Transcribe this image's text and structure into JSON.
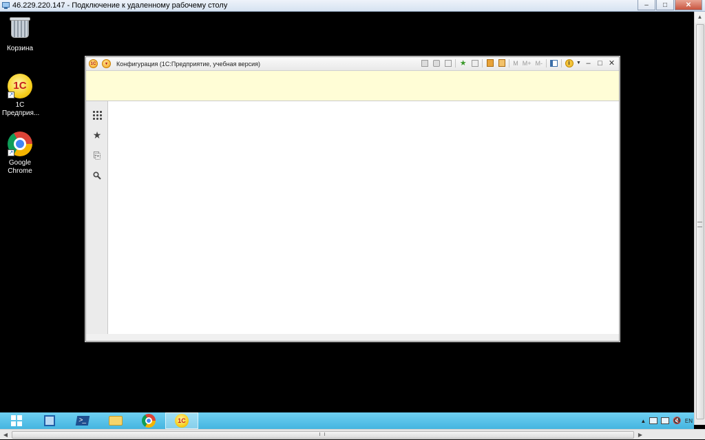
{
  "rdp_window": {
    "title": "46.229.220.147 - Подключение к удаленному рабочему столу",
    "minimize_label": "‒",
    "maximize_label": "□",
    "close_label": "✕"
  },
  "desktop_icons": [
    {
      "label": "Корзина",
      "icon": "recycle-bin-icon"
    },
    {
      "label": "1С Предприя...",
      "icon": "1c-enterprise-icon"
    },
    {
      "label": "Google Chrome",
      "icon": "chrome-icon"
    }
  ],
  "app_window": {
    "title": "Конфигурация  (1С:Предприятие, учебная версия)",
    "logo_text": "1С",
    "toolbar": {
      "m_label": "M",
      "m_plus_label": "M+",
      "m_minus_label": "M-",
      "minimize_label": "‒",
      "maximize_label": "□",
      "close_label": "✕"
    },
    "sidebar": [
      {
        "name": "sections",
        "icon": "sections-grid-icon"
      },
      {
        "name": "favorites",
        "icon": "star-icon",
        "glyph": "★"
      },
      {
        "name": "history",
        "icon": "history-icon",
        "glyph": "⎘"
      },
      {
        "name": "search",
        "icon": "search-icon",
        "glyph": "🔍"
      }
    ]
  },
  "taskbar": {
    "items": [
      "start",
      "server-manager",
      "powershell",
      "explorer",
      "chrome",
      "1c-enterprise"
    ],
    "active_item": "1c-enterprise",
    "tray_language": "EN",
    "onec_label": "1С",
    "ps_label": ">_"
  },
  "colors": {
    "desktop_bg": "#000000",
    "taskbar": "#45b5e0",
    "info_bar": "#fffdd6"
  }
}
